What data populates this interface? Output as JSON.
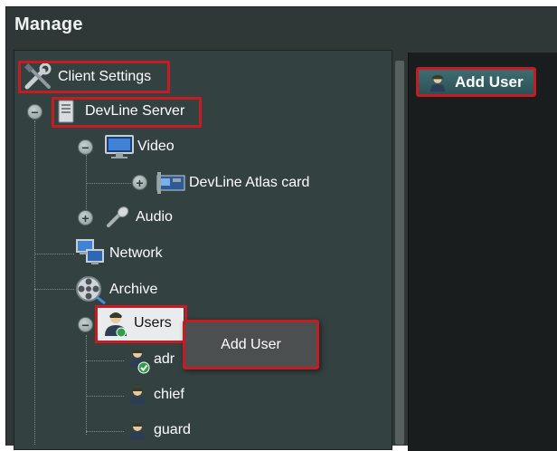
{
  "window": {
    "title": "Manage"
  },
  "toolbar": {
    "add_user_label": "Add User"
  },
  "tree": {
    "client_settings": "Client Settings",
    "server": "DevLine Server",
    "video": "Video",
    "atlas_card": "DevLine Atlas card",
    "audio": "Audio",
    "network": "Network",
    "archive": "Archive",
    "users": "Users",
    "admin": "adr",
    "chief": "chief",
    "guard": "guard"
  },
  "context_menu": {
    "add_user": "Add User"
  },
  "colors": {
    "highlight": "#c41c22",
    "panel": "#334141",
    "accent_button": "#3d6c70"
  }
}
